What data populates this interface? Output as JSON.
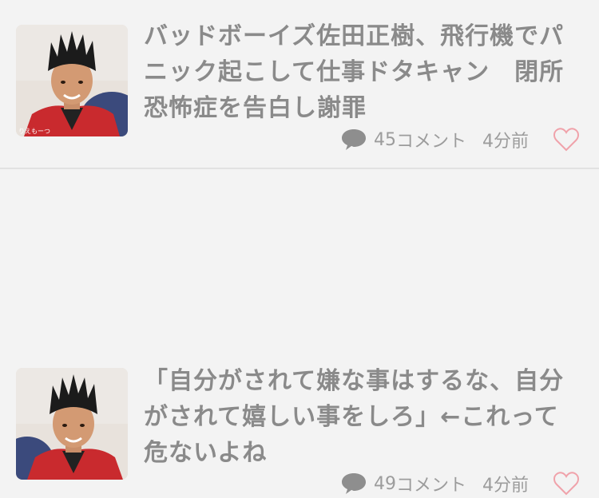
{
  "items": [
    {
      "title": "バッドボーイズ佐田正樹、飛行機でパニック起こして仕事ドタキャン　閉所恐怖症を告白し謝罪",
      "comment_count": "45",
      "comment_label": "コメント",
      "time_ago": "4分前",
      "thumb_caption": "りえもーつ"
    },
    {
      "title": "「自分がされて嫌な事はするな、自分がされて嬉しい事をしろ」←これって危ないよね",
      "comment_count": "49",
      "comment_label": "コメント",
      "time_ago": "4分前"
    }
  ],
  "icons": {
    "comment": "speech-bubble-icon",
    "like": "heart-outline-icon"
  },
  "colors": {
    "background": "#f3f3f3",
    "text": "#8a8a8a",
    "meta_text": "#9c9c9c",
    "heart": "#f0a2aa",
    "divider": "#e2e2e2"
  }
}
